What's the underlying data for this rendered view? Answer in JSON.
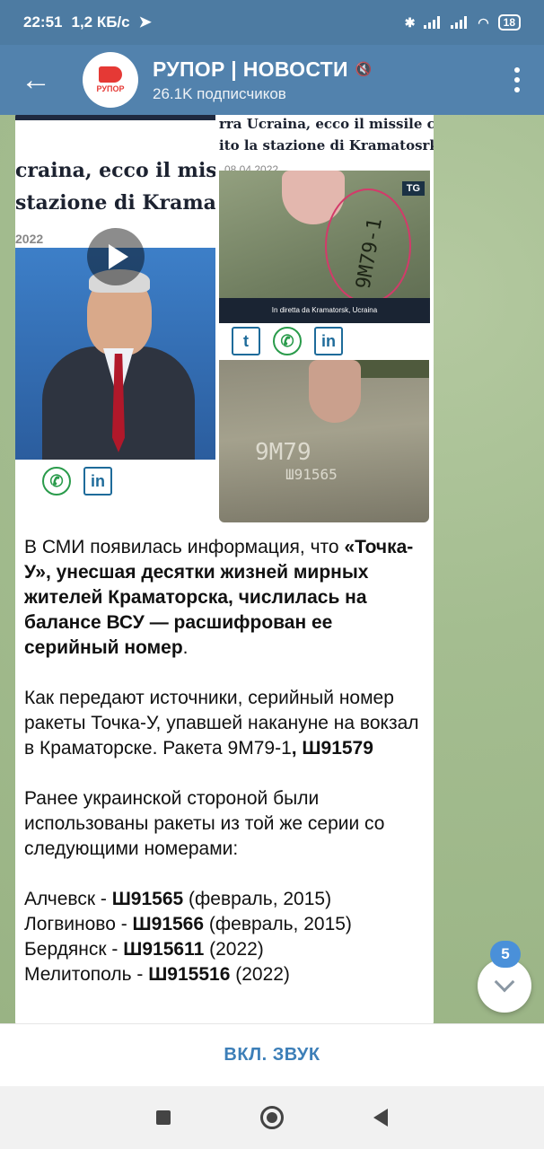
{
  "status": {
    "time": "22:51",
    "speed": "1,2 КБ/с",
    "battery": "18"
  },
  "header": {
    "title": "РУПОР | НОВОСТИ",
    "subscribers": "26.1K подписчиков",
    "avatar_text": "РУПОР"
  },
  "media": {
    "left_headline_1": "craina, ecco il missil",
    "left_headline_2": "stazione di Kramato",
    "left_date": "2022",
    "right_headline_1": "rra Ucraina, ecco il missile ch",
    "right_headline_2": "ito la stazione di Kramatosrk",
    "right_date": "08.04.2022",
    "rocket_code": "9M79-1",
    "rocket_badge": "TG",
    "rocket_caption": "In diretta da Kramatorsk, Ucraina",
    "photo_code": "9M79",
    "photo_serial": "Ш91565"
  },
  "message": {
    "p1_a": "В СМИ появилась информация, что ",
    "p1_b": "«Точка-У», унесшая десятки жизней мирных жителей Краматорска, числилась на балансе ВСУ — расшифрован ее серийный номер",
    "p1_c": ".",
    "p2_a": "Как передают источники, серийный номер ракеты Точка-У, упавшей накануне на вокзал в Краматорске. Ракета 9М79-1",
    "p2_b": ", Ш91579",
    "p3": "Ранее украинской стороной были использованы ракеты из той же серии со следующими номерами:",
    "items": [
      {
        "place": "Алчевск - ",
        "serial": "Ш91565",
        "date": " (февраль, 2015)"
      },
      {
        "place": "Логвиново - ",
        "serial": "Ш91566",
        "date": " (февраль, 2015)"
      },
      {
        "place": "Бердянск - ",
        "serial": "Ш915611",
        "date": " (2022)"
      },
      {
        "place": "Мелитополь - ",
        "serial": "Ш915516",
        "date": " (2022)"
      }
    ]
  },
  "unread_badge": "5",
  "bottom_action": "ВКЛ. ЗВУК"
}
